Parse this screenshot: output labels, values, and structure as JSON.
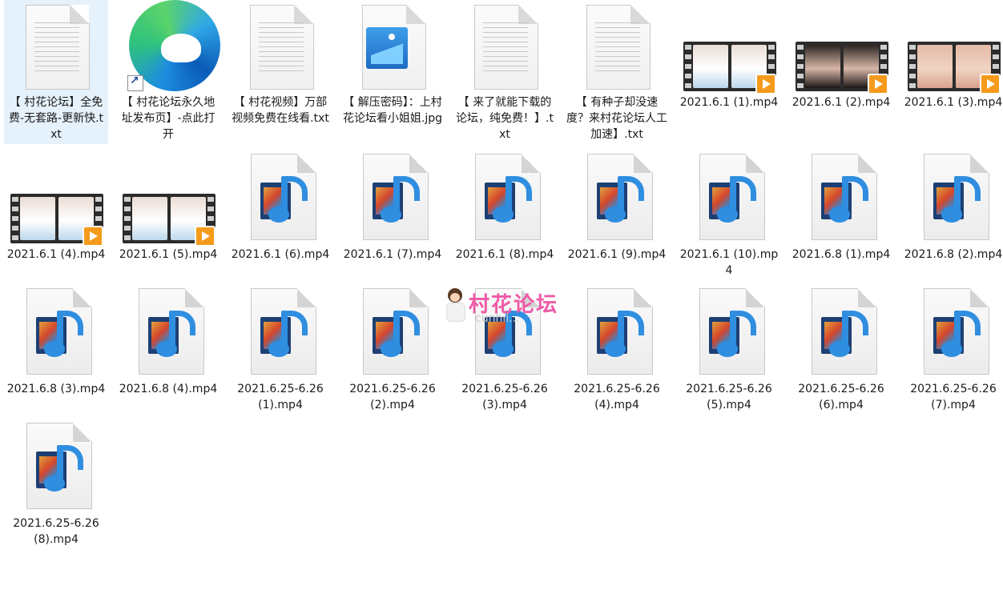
{
  "files": [
    {
      "id": "f1",
      "label": "【 村花论坛】全免费-无套路-更新快.txt",
      "type": "txt",
      "selected": true
    },
    {
      "id": "f2",
      "label": "【 村花论坛永久地址发布页】-点此打开",
      "type": "edge-shortcut"
    },
    {
      "id": "f3",
      "label": "【 村花视频】万部视频免费在线看.txt",
      "type": "txt"
    },
    {
      "id": "f4",
      "label": "【 解压密码】：上村花论坛看小姐姐.jpg",
      "type": "jpg"
    },
    {
      "id": "f5",
      "label": "【 来了就能下载的论坛，纯免费！】.txt",
      "type": "txt"
    },
    {
      "id": "f6",
      "label": "【 有种子却没速度？来村花论坛人工加速】.txt",
      "type": "txt"
    },
    {
      "id": "f7",
      "label": "2021.6.1 (1).mp4",
      "type": "video-thumb",
      "thumb": "white"
    },
    {
      "id": "f8",
      "label": "2021.6.1 (2).mp4",
      "type": "video-thumb",
      "thumb": "black"
    },
    {
      "id": "f9",
      "label": "2021.6.1 (3).mp4",
      "type": "video-thumb",
      "thumb": "skin"
    },
    {
      "id": "f10",
      "label": "2021.6.1 (4).mp4",
      "type": "video-thumb",
      "thumb": "white"
    },
    {
      "id": "f11",
      "label": "2021.6.1 (5).mp4",
      "type": "video-thumb",
      "thumb": "white"
    },
    {
      "id": "f12",
      "label": "2021.6.1 (6).mp4",
      "type": "media"
    },
    {
      "id": "f13",
      "label": "2021.6.1 (7).mp4",
      "type": "media"
    },
    {
      "id": "f14",
      "label": "2021.6.1 (8).mp4",
      "type": "media"
    },
    {
      "id": "f15",
      "label": "2021.6.1 (9).mp4",
      "type": "media"
    },
    {
      "id": "f16",
      "label": "2021.6.1 (10).mp4",
      "type": "media"
    },
    {
      "id": "f17",
      "label": "2021.6.8 (1).mp4",
      "type": "media"
    },
    {
      "id": "f18",
      "label": "2021.6.8 (2).mp4",
      "type": "media"
    },
    {
      "id": "f19",
      "label": "2021.6.8 (3).mp4",
      "type": "media"
    },
    {
      "id": "f20",
      "label": "2021.6.8 (4).mp4",
      "type": "media"
    },
    {
      "id": "f21",
      "label": "2021.6.25-6.26 (1).mp4",
      "type": "media"
    },
    {
      "id": "f22",
      "label": "2021.6.25-6.26 (2).mp4",
      "type": "media"
    },
    {
      "id": "f23",
      "label": "2021.6.25-6.26 (3).mp4",
      "type": "media"
    },
    {
      "id": "f24",
      "label": "2021.6.25-6.26 (4).mp4",
      "type": "media"
    },
    {
      "id": "f25",
      "label": "2021.6.25-6.26 (5).mp4",
      "type": "media"
    },
    {
      "id": "f26",
      "label": "2021.6.25-6.26 (6).mp4",
      "type": "media"
    },
    {
      "id": "f27",
      "label": "2021.6.25-6.26 (7).mp4",
      "type": "media"
    },
    {
      "id": "f28",
      "label": "2021.6.25-6.26 (8).mp4",
      "type": "media"
    }
  ],
  "watermark": {
    "title": "村花论坛",
    "url": "cunhil..."
  },
  "colors": {
    "selection": "#e5f1fb",
    "play": "#f59a1b",
    "media_blue": "#2f8ee0",
    "watermark": "#ef5aa6"
  }
}
